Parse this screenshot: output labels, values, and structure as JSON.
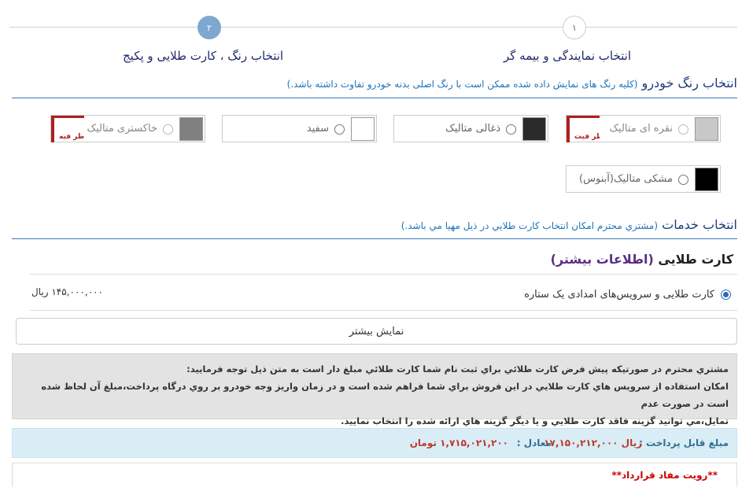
{
  "steps": [
    {
      "number": "۱",
      "label": "انتخاب نمایندگی و بیمه گر"
    },
    {
      "number": "۲",
      "label": "انتخاب رنگ ، کارت طلایی و پکیج"
    }
  ],
  "color_section": {
    "title": "انتخاب رنگ خودرو",
    "note": "(کلیه رنگ های نمایش داده شده ممکن است با رنگ اصلی بدنه خودرو تفاوت داشته باشد.)",
    "options": [
      {
        "label": "نقره ای متالیک",
        "color": "#c8c8c8",
        "disabled": true,
        "stamp": "ظر فیت"
      },
      {
        "label": "ذغالی متالیک",
        "color": "#2b2b2b",
        "disabled": false
      },
      {
        "label": "سفید",
        "color": "#ffffff",
        "disabled": false
      },
      {
        "label": "خاکستری متالیک",
        "color": "#808080",
        "disabled": true,
        "stamp": "ظر فیه"
      },
      {
        "label": "مشکی متالیک(آبنوس)",
        "color": "#000000",
        "disabled": false
      }
    ]
  },
  "services_section": {
    "title": "انتخاب خدمات",
    "note": "(مشتري محترم امكان انتخاب كارت طلايي در ذيل مهيا مي باشد.)"
  },
  "gold_card": {
    "title": "کارت طلایی",
    "more_info": "(اطلاعات بیشتر)",
    "option_label": "کارت طلایی و سرویس‌های امدادی یک ستاره",
    "price": "۱۴۵,۰۰۰,۰۰۰ ریال"
  },
  "show_more_label": "نمایش بیشتر",
  "info_lines": [
    "مشتري محترم در صورتيكه پيش فرض كارت طلائي براي ثبت نام شما كارت طلائي مبلغ دار است به متن ذيل توجه فرماييد:",
    "امكان استفاده از سرويس هاي كارت طلايي در اين فروش براي شما فراهم شده است و در زمان واريز وجه خودرو بر روي درگاه پرداخت،مبلغ آن لحاظ شده است در صورت عدم",
    "تمايل،مي توانيد گزينه فاقد كارت طلايي و يا ديگر گزينه هاي ارائه شده را انتخاب نماييد."
  ],
  "payment": {
    "label": "مبلغ قابل پرداخت :",
    "amount_rial": "۱۷,۱۵۰,۲۱۲,۰۰۰ ریال",
    "equiv_label": "معادل :",
    "amount_toman": "۱,۷۱۵,۰۲۱,۲۰۰ تومان"
  },
  "contract_title": "**رویت مفاد قرارداد**"
}
